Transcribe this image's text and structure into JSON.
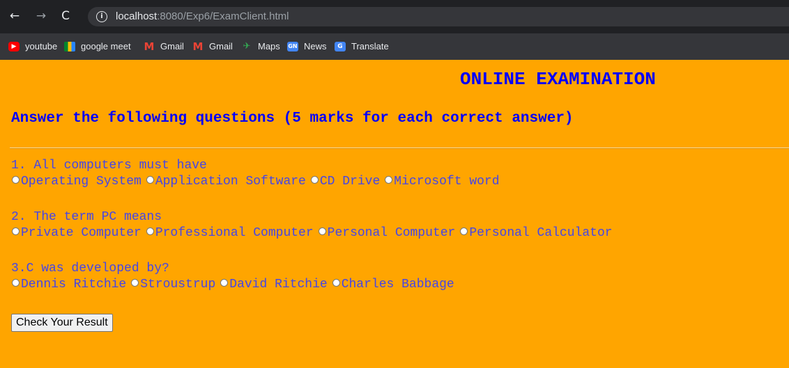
{
  "browser": {
    "url_host": "localhost",
    "url_rest": ":8080/Exp6/ExamClient.html",
    "back_glyph": "←",
    "forward_glyph": "→",
    "reload_glyph": "C",
    "info_glyph": "i"
  },
  "bookmarks": [
    {
      "label": "youtube",
      "icon": "youtube-icon"
    },
    {
      "label": "google meet",
      "icon": "google-meet-icon"
    },
    {
      "label": "Gmail",
      "icon": "gmail-icon"
    },
    {
      "label": "Gmail",
      "icon": "gmail-icon"
    },
    {
      "label": "Maps",
      "icon": "maps-icon"
    },
    {
      "label": "News",
      "icon": "news-icon"
    },
    {
      "label": "Translate",
      "icon": "translate-icon"
    }
  ],
  "page": {
    "title": "ONLINE EXAMINATION",
    "instruction": "Answer the following questions (5 marks for each correct answer)",
    "questions": [
      {
        "text": "1. All computers must have",
        "options": [
          "Operating System",
          "Application Software",
          "CD Drive",
          "Microsoft word"
        ]
      },
      {
        "text": "2. The term PC means",
        "options": [
          "Private Computer",
          "Professional Computer",
          "Personal Computer",
          "Personal Calculator"
        ]
      },
      {
        "text": "3.C was developed by?",
        "options": [
          "Dennis Ritchie",
          "Stroustrup",
          "David Ritchie",
          "Charles Babbage"
        ]
      }
    ],
    "submit_label": "Check Your Result"
  },
  "colors": {
    "page_background": "#ffa500",
    "heading_blue": "#0000ff",
    "question_text": "#4646e6",
    "browser_dark": "#202124"
  }
}
